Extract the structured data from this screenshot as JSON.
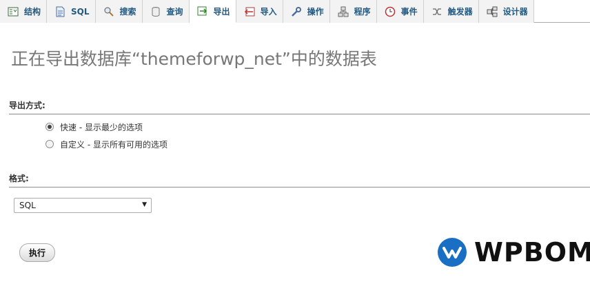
{
  "tabs": [
    {
      "label": "结构",
      "icon": "structure-icon",
      "active": false
    },
    {
      "label": "SQL",
      "icon": "sql-icon",
      "active": false
    },
    {
      "label": "搜索",
      "icon": "search-icon",
      "active": false
    },
    {
      "label": "查询",
      "icon": "query-icon",
      "active": false
    },
    {
      "label": "导出",
      "icon": "export-icon",
      "active": true
    },
    {
      "label": "导入",
      "icon": "import-icon",
      "active": false
    },
    {
      "label": "操作",
      "icon": "wrench-icon",
      "active": false
    },
    {
      "label": "程序",
      "icon": "routines-icon",
      "active": false
    },
    {
      "label": "事件",
      "icon": "clock-icon",
      "active": false
    },
    {
      "label": "触发器",
      "icon": "triggers-icon",
      "active": false
    },
    {
      "label": "设计器",
      "icon": "designer-icon",
      "active": false
    }
  ],
  "page_title": "正在导出数据库“themeforwp_net”中的数据表",
  "export_method": {
    "heading": "导出方式:",
    "options": [
      {
        "label": "快速 - 显示最少的选项",
        "checked": true
      },
      {
        "label": "自定义 - 显示所有可用的选项",
        "checked": false
      }
    ]
  },
  "format": {
    "heading": "格式:",
    "selected": "SQL"
  },
  "go_button": "执行",
  "brand": {
    "text": "WPBOM",
    "color": "#1a6fc4"
  }
}
